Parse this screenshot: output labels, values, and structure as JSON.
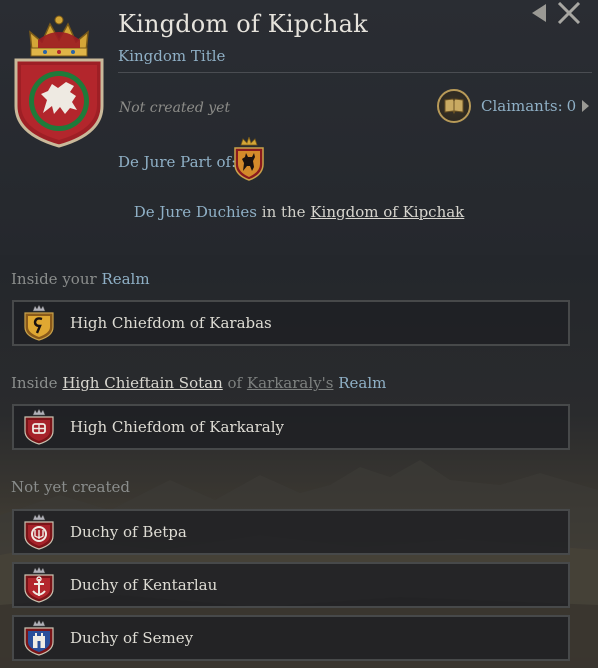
{
  "window": {
    "title": "Kingdom of Kipchak",
    "subtitle": "Kingdom Title",
    "status": "Not created yet",
    "back_icon": "triangle-left-icon",
    "close_icon": "close-icon"
  },
  "claimants": {
    "label": "Claimants:",
    "count": "0",
    "icon": "book-icon"
  },
  "dejure": {
    "label": "De Jure Part of:",
    "emblem_icon": "stag-emblem-icon"
  },
  "duchies_heading": {
    "part1": "De Jure Duchies",
    "part2": " in the ",
    "link": "Kingdom of Kipchak"
  },
  "sections": {
    "inside_realm": {
      "prefix": "Inside your ",
      "realm": "Realm"
    },
    "inside_other": {
      "prefix": "Inside ",
      "ruler": "High Chieftain Sotan",
      "of": " of ",
      "place": "Karkaraly's",
      "realm": " Realm"
    },
    "not_created": "Not yet created"
  },
  "rows": [
    {
      "name": "High Chiefdom of Karabas",
      "emblem": "hook-emblem-icon"
    },
    {
      "name": "High Chiefdom of Karkaraly",
      "emblem": "knot-emblem-icon"
    },
    {
      "name": "Duchy of Betpa",
      "emblem": "trident-emblem-icon"
    },
    {
      "name": "Duchy of Kentarlau",
      "emblem": "anchor-emblem-icon"
    },
    {
      "name": "Duchy of Semey",
      "emblem": "tower-emblem-icon"
    }
  ],
  "colors": {
    "accent_blue": "#8fb0c6",
    "gold": "#b89a58",
    "coa_red": "#b3262c",
    "coa_green": "#1f7a3a"
  }
}
